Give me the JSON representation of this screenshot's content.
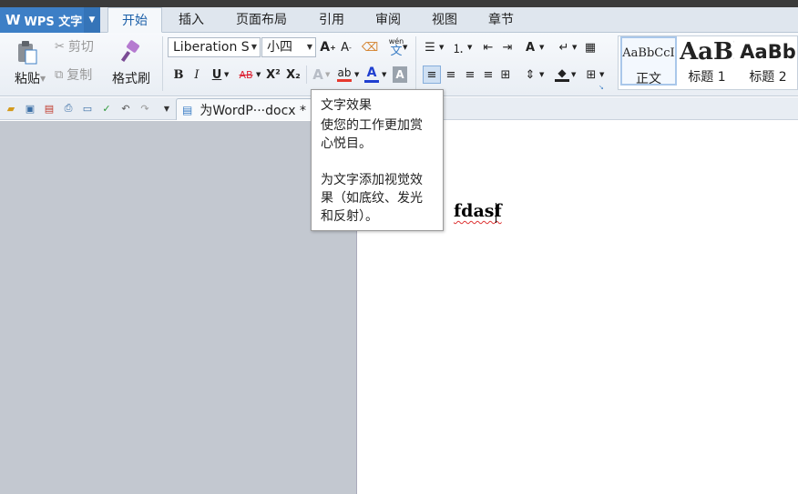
{
  "app": {
    "logo": "W",
    "name": "WPS 文字"
  },
  "tabs": [
    "开始",
    "插入",
    "页面布局",
    "引用",
    "审阅",
    "视图",
    "章节"
  ],
  "clipboard": {
    "paste": "粘贴",
    "cut": "剪切",
    "copy": "复制",
    "format_painter": "格式刷"
  },
  "font": {
    "family": "Liberation S",
    "size": "小四",
    "wen": "wén",
    "wen_char": "文"
  },
  "format_buttons": [
    "B",
    "I",
    "U",
    "AB",
    "X²",
    "X₂",
    "A"
  ],
  "styles": [
    {
      "sample": "AaBbCcI",
      "label": "正文"
    },
    {
      "sample": "AaBl",
      "label": "标题 1"
    },
    {
      "sample": "AaBb",
      "label": "标题 2"
    }
  ],
  "document": {
    "tab_title": "为WordP···docx *",
    "text": "fdasf"
  },
  "tooltip": {
    "title": "文字效果",
    "line1": "使您的工作更加赏心悦目。",
    "line2": "为文字添加视觉效果（如底纹、发光和反射）。"
  },
  "colors": {
    "accent": "#3d7fc6",
    "font_color": "#1f3fd0",
    "highlight": "#e6392e",
    "spell_error": "#d33333"
  }
}
